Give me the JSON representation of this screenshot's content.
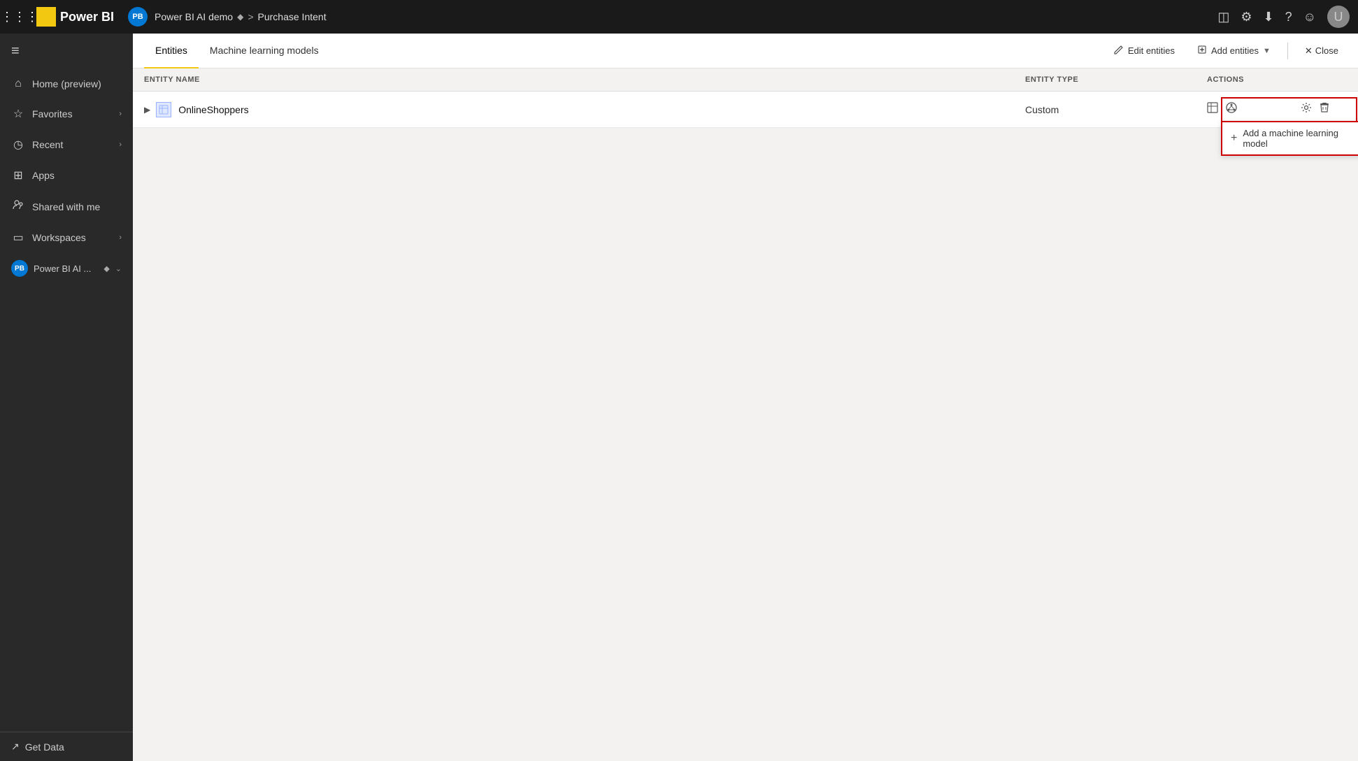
{
  "topbar": {
    "waffle_label": "⊞",
    "logo_text": "Power BI",
    "logo_icon": "PB",
    "breadcrumb": {
      "avatar_label": "PB",
      "workspace_name": "Power BI AI demo",
      "diamond_char": "◆",
      "separator": ">",
      "page_name": "Purchase Intent"
    },
    "icons": {
      "monitor": "□",
      "settings": "⚙",
      "download": "⬇",
      "help": "?",
      "smiley": "☺"
    }
  },
  "sidebar": {
    "menu_icon": "≡",
    "items": [
      {
        "id": "home",
        "icon": "⌂",
        "label": "Home (preview)",
        "has_chevron": false
      },
      {
        "id": "favorites",
        "icon": "☆",
        "label": "Favorites",
        "has_chevron": true
      },
      {
        "id": "recent",
        "icon": "◷",
        "label": "Recent",
        "has_chevron": true
      },
      {
        "id": "apps",
        "icon": "⊞",
        "label": "Apps",
        "has_chevron": false
      },
      {
        "id": "shared",
        "icon": "👤",
        "label": "Shared with me",
        "has_chevron": false
      },
      {
        "id": "workspaces",
        "icon": "◫",
        "label": "Workspaces",
        "has_chevron": true
      }
    ],
    "workspace_item": {
      "avatar": "PB",
      "label": "Power BI AI ...",
      "diamond": "◆",
      "has_chevron": true
    },
    "get_data": {
      "icon": "↗",
      "label": "Get Data"
    }
  },
  "content": {
    "tabs": [
      {
        "id": "entities",
        "label": "Entities",
        "active": true
      },
      {
        "id": "ml_models",
        "label": "Machine learning models",
        "active": false
      }
    ],
    "toolbar_actions": {
      "edit_entities_icon": "✎",
      "edit_entities_label": "Edit entities",
      "add_entities_icon": "+",
      "add_entities_label": "Add entities",
      "dropdown_arrow": "▾",
      "close_icon": "✕",
      "close_label": "Close"
    },
    "table": {
      "col_entity_name": "ENTITY NAME",
      "col_entity_type": "ENTITY TYPE",
      "col_actions": "ACTIONS",
      "rows": [
        {
          "id": "online-shoppers",
          "expand_icon": "▶",
          "entity_icon": "⊟",
          "name": "OnlineShoppers",
          "type": "Custom",
          "actions": [
            "table-icon",
            "refresh-icon",
            "settings-icon",
            "delete-icon"
          ]
        }
      ]
    },
    "ml_dropdown": {
      "plus_icon": "+",
      "label": "Add a machine learning model"
    }
  }
}
